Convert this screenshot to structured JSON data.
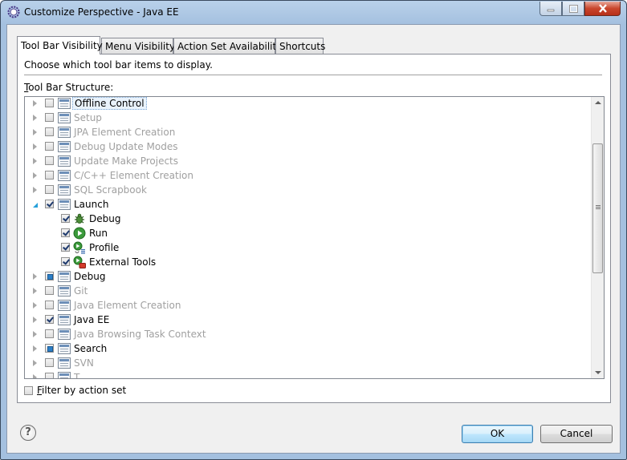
{
  "window": {
    "title": "Customize Perspective - Java EE"
  },
  "tabs": [
    {
      "label": "Tool Bar Visibility",
      "active": true
    },
    {
      "label": "Menu Visibility",
      "active": false
    },
    {
      "label": "Action Set Availability",
      "active": false
    },
    {
      "label": "Shortcuts",
      "active": false
    }
  ],
  "panel": {
    "description": "Choose which tool bar items to display.",
    "structure_label_mnemonic": "T",
    "structure_label_rest": "ool Bar Structure:"
  },
  "tree": [
    {
      "label": "Offline Control",
      "level": 0,
      "expander": "collapsed",
      "check": "unchecked",
      "disabled": false,
      "selected": true,
      "icon": "toolbar-icon"
    },
    {
      "label": "Setup",
      "level": 0,
      "expander": "collapsed",
      "check": "unchecked",
      "disabled": true,
      "icon": "toolbar-icon"
    },
    {
      "label": "JPA Element Creation",
      "level": 0,
      "expander": "collapsed",
      "check": "unchecked",
      "disabled": true,
      "icon": "toolbar-icon"
    },
    {
      "label": "Debug Update Modes",
      "level": 0,
      "expander": "collapsed",
      "check": "unchecked",
      "disabled": true,
      "icon": "toolbar-icon"
    },
    {
      "label": "Update Make Projects",
      "level": 0,
      "expander": "collapsed",
      "check": "unchecked",
      "disabled": true,
      "icon": "toolbar-icon"
    },
    {
      "label": "C/C++ Element Creation",
      "level": 0,
      "expander": "collapsed",
      "check": "unchecked",
      "disabled": true,
      "icon": "toolbar-icon"
    },
    {
      "label": "SQL Scrapbook",
      "level": 0,
      "expander": "collapsed",
      "check": "unchecked",
      "disabled": true,
      "icon": "toolbar-icon"
    },
    {
      "label": "Launch",
      "level": 0,
      "expander": "expanded",
      "check": "checked",
      "disabled": false,
      "icon": "toolbar-icon"
    },
    {
      "label": "Debug",
      "level": 1,
      "expander": "none",
      "check": "checked",
      "disabled": false,
      "icon": "debug-bug-icon"
    },
    {
      "label": "Run",
      "level": 1,
      "expander": "none",
      "check": "checked",
      "disabled": false,
      "icon": "run-icon"
    },
    {
      "label": "Profile",
      "level": 1,
      "expander": "none",
      "check": "checked",
      "disabled": false,
      "icon": "profile-icon"
    },
    {
      "label": "External Tools",
      "level": 1,
      "expander": "none",
      "check": "checked",
      "disabled": false,
      "icon": "external-tools-icon"
    },
    {
      "label": "Debug",
      "level": 0,
      "expander": "collapsed",
      "check": "partial",
      "disabled": false,
      "icon": "toolbar-icon"
    },
    {
      "label": "Git",
      "level": 0,
      "expander": "collapsed",
      "check": "unchecked",
      "disabled": true,
      "icon": "toolbar-icon"
    },
    {
      "label": "Java Element Creation",
      "level": 0,
      "expander": "collapsed",
      "check": "unchecked",
      "disabled": true,
      "icon": "toolbar-icon"
    },
    {
      "label": "Java EE",
      "level": 0,
      "expander": "collapsed",
      "check": "checked",
      "disabled": false,
      "icon": "toolbar-icon"
    },
    {
      "label": "Java Browsing Task Context",
      "level": 0,
      "expander": "collapsed",
      "check": "unchecked",
      "disabled": true,
      "icon": "toolbar-icon"
    },
    {
      "label": "Search",
      "level": 0,
      "expander": "collapsed",
      "check": "partial",
      "disabled": false,
      "icon": "toolbar-icon"
    },
    {
      "label": "SVN",
      "level": 0,
      "expander": "collapsed",
      "check": "unchecked",
      "disabled": true,
      "icon": "toolbar-icon"
    },
    {
      "label": "T...",
      "level": 0,
      "expander": "collapsed",
      "check": "unchecked",
      "disabled": true,
      "icon": "toolbar-icon"
    }
  ],
  "filter": {
    "mnemonic": "F",
    "label_rest": "ilter by action set",
    "checked": false
  },
  "buttons": {
    "ok": "OK",
    "cancel": "Cancel",
    "help": "?"
  }
}
